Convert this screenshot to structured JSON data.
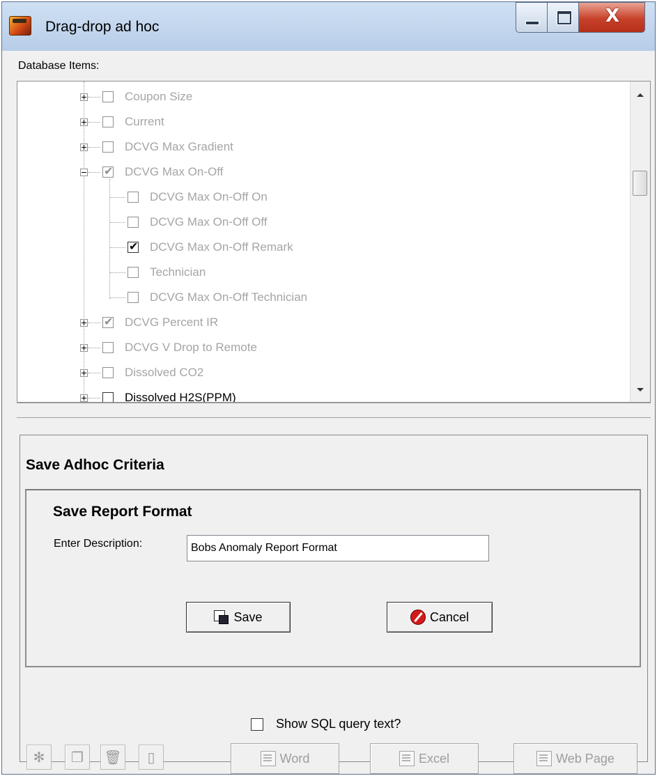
{
  "window": {
    "title": "Drag-drop ad hoc",
    "close_glyph": "X"
  },
  "database": {
    "label": "Database Items:",
    "items": [
      {
        "label": "Coupon Size",
        "checked": false
      },
      {
        "label": "Current",
        "checked": false
      },
      {
        "label": "DCVG Max Gradient",
        "checked": false
      },
      {
        "label": "DCVG Max On-Off",
        "checked": true
      },
      {
        "label": "DCVG Max On-Off On",
        "checked": false
      },
      {
        "label": "DCVG Max On-Off Off",
        "checked": false
      },
      {
        "label": "DCVG Max On-Off Remark",
        "checked": true
      },
      {
        "label": "Technician",
        "checked": false
      },
      {
        "label": "DCVG Max On-Off Technician",
        "checked": false
      },
      {
        "label": "DCVG Percent IR",
        "checked": true
      },
      {
        "label": "DCVG V Drop to Remote",
        "checked": false
      },
      {
        "label": "Dissolved CO2",
        "checked": false
      },
      {
        "label": "Dissolved H2S(PPM)",
        "checked": false
      }
    ]
  },
  "save_criteria": {
    "title": "Save Adhoc Criteria",
    "report_format": {
      "title": "Save Report Format",
      "description_label": "Enter Description:",
      "description_value": "Bobs Anomaly Report Format",
      "save_label": "Save",
      "cancel_label": "Cancel"
    }
  },
  "footer": {
    "show_sql_label": "Show SQL query text?",
    "show_sql_checked": false,
    "word_label": "Word",
    "excel_label": "Excel",
    "webpage_label": "Web Page"
  },
  "icons": [
    "app-icon",
    "minimize-icon",
    "maximize-icon",
    "close-icon",
    "save-icon",
    "cancel-icon",
    "clear-icon",
    "copy-icon",
    "delete-icon",
    "blank-page-icon",
    "document-icon"
  ]
}
